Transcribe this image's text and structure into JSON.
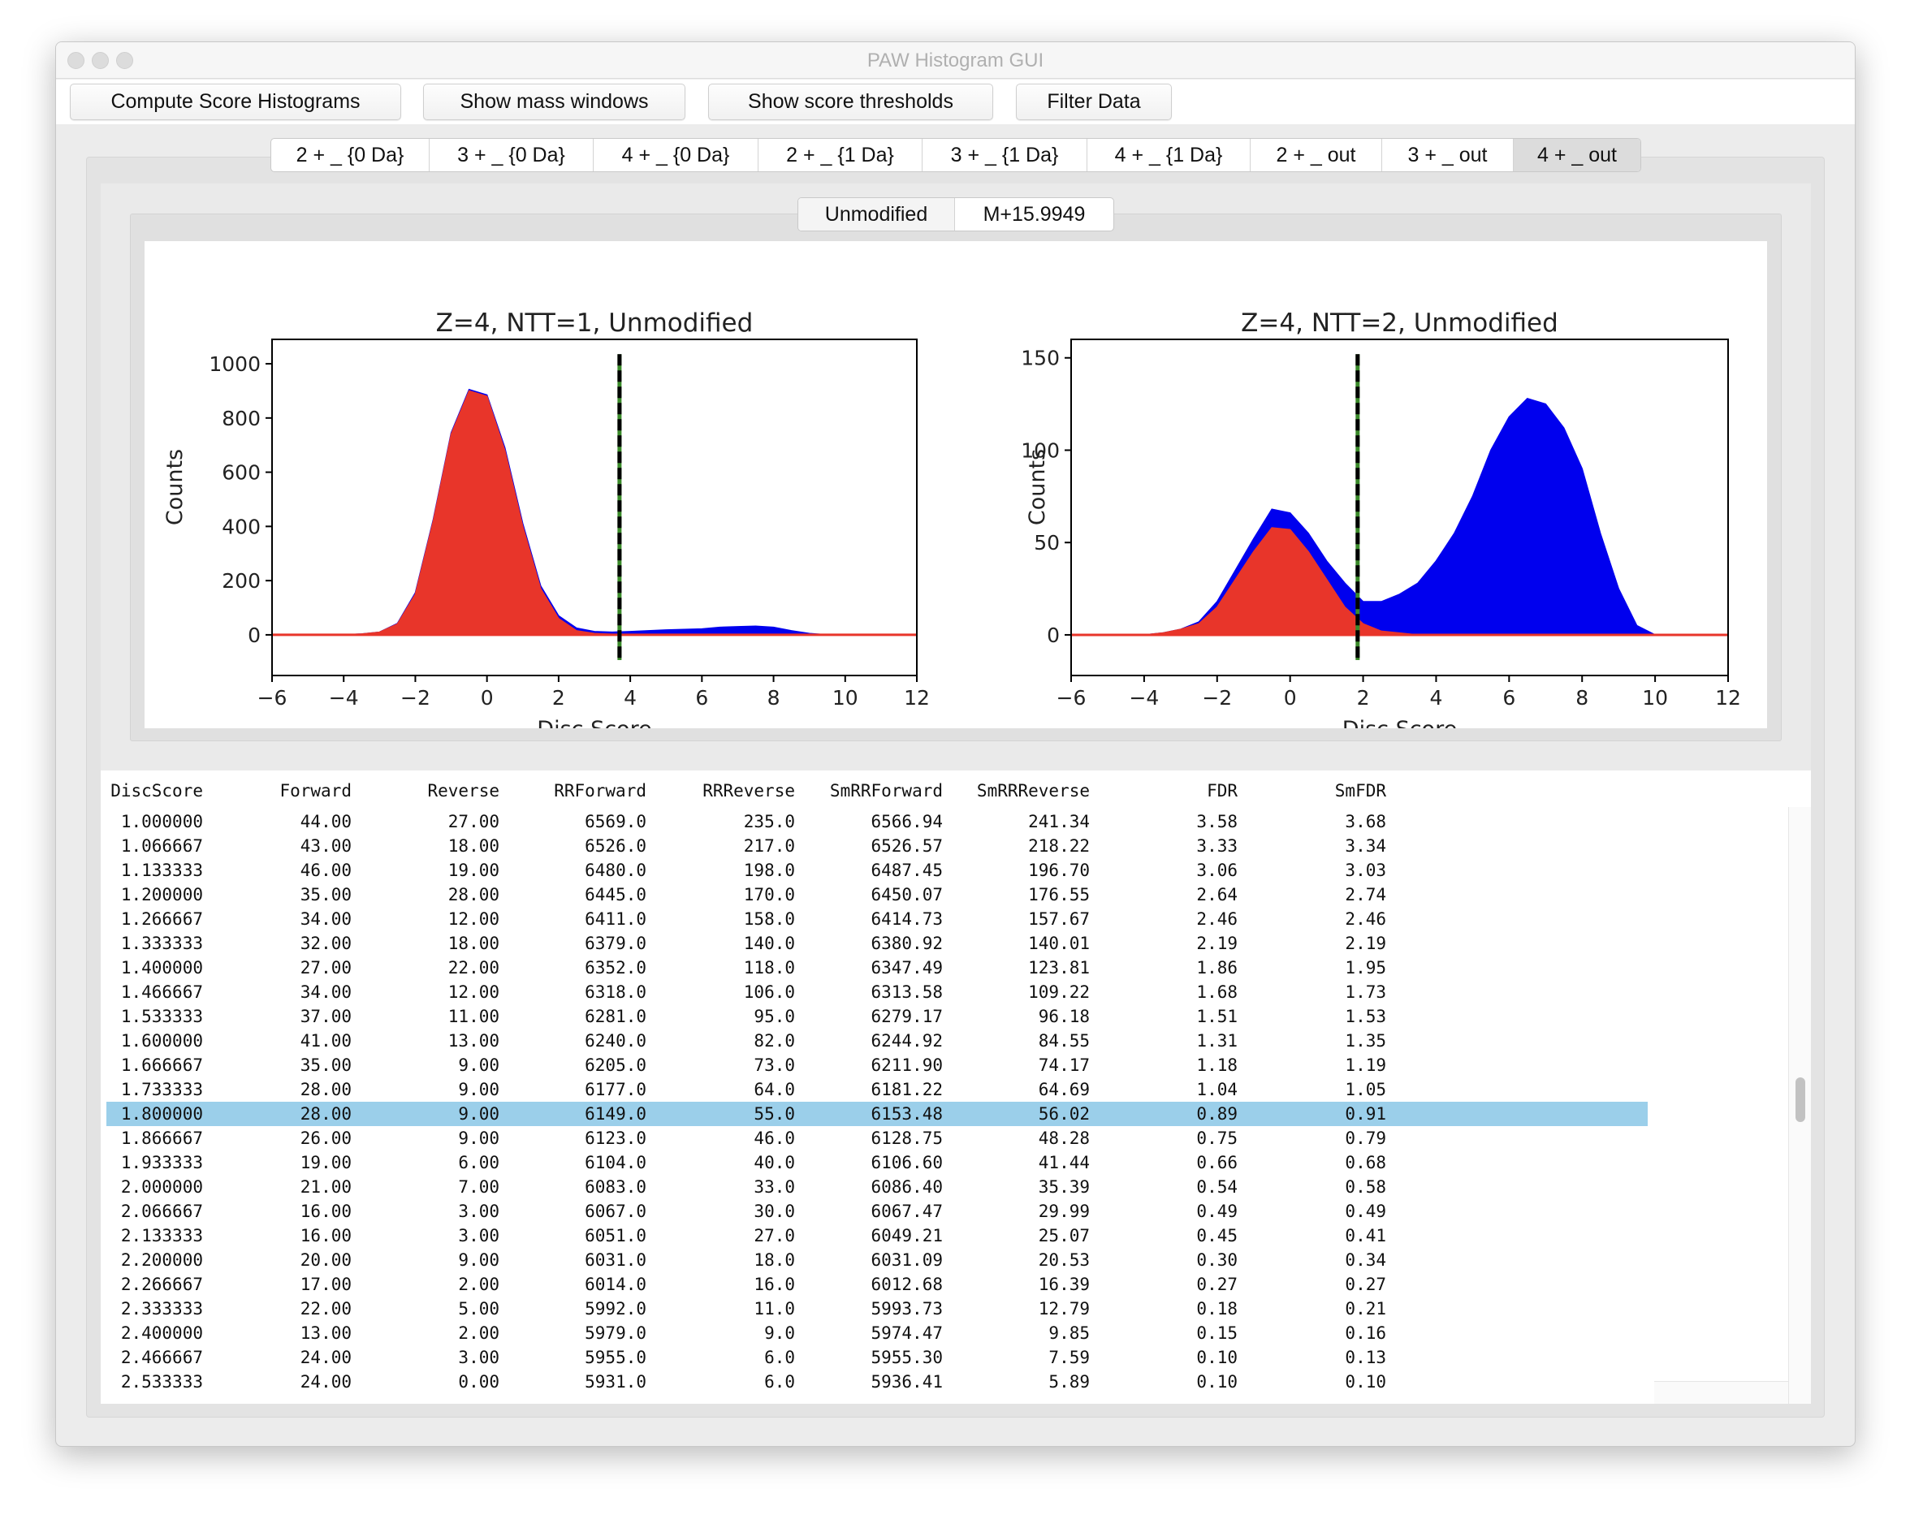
{
  "window": {
    "title": "PAW Histogram GUI"
  },
  "toolbar": {
    "buttons": [
      "Compute Score Histograms",
      "Show mass windows",
      "Show score thresholds",
      "Filter Data"
    ]
  },
  "tabs": {
    "items": [
      "2 + _ {0 Da}",
      "3 + _ {0 Da}",
      "4 + _ {0 Da}",
      "2 + _ {1 Da}",
      "3 + _ {1 Da}",
      "4 + _ {1 Da}",
      "2 + _ out",
      "3 + _ out",
      "4 + _ out"
    ],
    "selected": "4 + _ out"
  },
  "subtabs": {
    "items": [
      "Unmodified",
      "M+15.9949"
    ],
    "selected": "Unmodified"
  },
  "colors": {
    "forward": "#0000ee",
    "reverse": "#e8352a",
    "threshold": "#000000",
    "threshold_dash_alt": "#3a8a2a",
    "selected_row": "#9bcfea"
  },
  "chart_data": [
    {
      "type": "area",
      "title": "Z=4, NTT=1, Unmodified",
      "xlabel": "Disc Score",
      "ylabel": "Counts",
      "xlim": [
        -6,
        12
      ],
      "ylim": [
        -150,
        1090
      ],
      "xticks": [
        "−6",
        "−4",
        "−2",
        "0",
        "2",
        "4",
        "6",
        "8",
        "10",
        "12"
      ],
      "yticks": [
        "0",
        "200",
        "400",
        "600",
        "800",
        "1000"
      ],
      "ytick_values": [
        0,
        200,
        400,
        600,
        800,
        1000
      ],
      "threshold": 3.7,
      "x": [
        -4,
        -3.5,
        -3,
        -2.5,
        -2,
        -1.5,
        -1,
        -0.5,
        0,
        0.5,
        1,
        1.5,
        2,
        2.5,
        3,
        3.5,
        4,
        4.5,
        5,
        5.5,
        6,
        6.5,
        7,
        7.5,
        8,
        8.5,
        9,
        9.5,
        10
      ],
      "series": [
        {
          "color": "#0000ee",
          "values": [
            0,
            3,
            10,
            42,
            155,
            425,
            745,
            905,
            885,
            690,
            410,
            180,
            70,
            25,
            12,
            10,
            12,
            15,
            18,
            20,
            22,
            28,
            30,
            32,
            28,
            15,
            5,
            0,
            0
          ]
        },
        {
          "color": "#e8352a",
          "values": [
            0,
            3,
            10,
            40,
            150,
            420,
            740,
            900,
            880,
            680,
            400,
            170,
            60,
            15,
            5,
            2,
            0,
            0,
            0,
            0,
            0,
            0,
            0,
            0,
            0,
            0,
            0,
            0,
            0
          ]
        }
      ]
    },
    {
      "type": "area",
      "title": "Z=4, NTT=2, Unmodified",
      "xlabel": "Disc Score",
      "ylabel": "Counts",
      "xlim": [
        -6,
        12
      ],
      "ylim": [
        -22,
        160
      ],
      "xticks": [
        "−6",
        "−4",
        "−2",
        "0",
        "2",
        "4",
        "6",
        "8",
        "10",
        "12"
      ],
      "yticks": [
        "0",
        "50",
        "100",
        "150"
      ],
      "ytick_values": [
        0,
        50,
        100,
        150
      ],
      "threshold": 1.85,
      "x": [
        -4,
        -3.5,
        -3,
        -2.5,
        -2,
        -1.5,
        -1,
        -0.5,
        0,
        0.5,
        1,
        1.5,
        2,
        2.5,
        3,
        3.5,
        4,
        4.5,
        5,
        5.5,
        6,
        6.5,
        7,
        7.5,
        8,
        8.5,
        9,
        9.5,
        10
      ],
      "series": [
        {
          "color": "#0000ee",
          "values": [
            0,
            1,
            3,
            7,
            18,
            35,
            52,
            68,
            66,
            55,
            40,
            28,
            18,
            18,
            22,
            28,
            40,
            55,
            75,
            100,
            118,
            128,
            125,
            112,
            90,
            55,
            25,
            5,
            0
          ]
        },
        {
          "color": "#e8352a",
          "values": [
            0,
            1,
            3,
            6,
            15,
            30,
            45,
            58,
            57,
            45,
            30,
            15,
            6,
            2,
            1,
            0,
            0,
            0,
            0,
            0,
            0,
            0,
            0,
            0,
            0,
            0,
            0,
            0,
            0
          ]
        }
      ]
    }
  ],
  "table": {
    "columns": [
      "DiscScore",
      "Forward",
      "Reverse",
      "RRForward",
      "RRReverse",
      "SmRRForward",
      "SmRRReverse",
      "FDR",
      "SmFDR"
    ],
    "selected_index": 12,
    "rows": [
      [
        "1.000000",
        "44.00",
        "27.00",
        "6569.0",
        "235.0",
        "6566.94",
        "241.34",
        "3.58",
        "3.68"
      ],
      [
        "1.066667",
        "43.00",
        "18.00",
        "6526.0",
        "217.0",
        "6526.57",
        "218.22",
        "3.33",
        "3.34"
      ],
      [
        "1.133333",
        "46.00",
        "19.00",
        "6480.0",
        "198.0",
        "6487.45",
        "196.70",
        "3.06",
        "3.03"
      ],
      [
        "1.200000",
        "35.00",
        "28.00",
        "6445.0",
        "170.0",
        "6450.07",
        "176.55",
        "2.64",
        "2.74"
      ],
      [
        "1.266667",
        "34.00",
        "12.00",
        "6411.0",
        "158.0",
        "6414.73",
        "157.67",
        "2.46",
        "2.46"
      ],
      [
        "1.333333",
        "32.00",
        "18.00",
        "6379.0",
        "140.0",
        "6380.92",
        "140.01",
        "2.19",
        "2.19"
      ],
      [
        "1.400000",
        "27.00",
        "22.00",
        "6352.0",
        "118.0",
        "6347.49",
        "123.81",
        "1.86",
        "1.95"
      ],
      [
        "1.466667",
        "34.00",
        "12.00",
        "6318.0",
        "106.0",
        "6313.58",
        "109.22",
        "1.68",
        "1.73"
      ],
      [
        "1.533333",
        "37.00",
        "11.00",
        "6281.0",
        "95.0",
        "6279.17",
        "96.18",
        "1.51",
        "1.53"
      ],
      [
        "1.600000",
        "41.00",
        "13.00",
        "6240.0",
        "82.0",
        "6244.92",
        "84.55",
        "1.31",
        "1.35"
      ],
      [
        "1.666667",
        "35.00",
        "9.00",
        "6205.0",
        "73.0",
        "6211.90",
        "74.17",
        "1.18",
        "1.19"
      ],
      [
        "1.733333",
        "28.00",
        "9.00",
        "6177.0",
        "64.0",
        "6181.22",
        "64.69",
        "1.04",
        "1.05"
      ],
      [
        "1.800000",
        "28.00",
        "9.00",
        "6149.0",
        "55.0",
        "6153.48",
        "56.02",
        "0.89",
        "0.91"
      ],
      [
        "1.866667",
        "26.00",
        "9.00",
        "6123.0",
        "46.0",
        "6128.75",
        "48.28",
        "0.75",
        "0.79"
      ],
      [
        "1.933333",
        "19.00",
        "6.00",
        "6104.0",
        "40.0",
        "6106.60",
        "41.44",
        "0.66",
        "0.68"
      ],
      [
        "2.000000",
        "21.00",
        "7.00",
        "6083.0",
        "33.0",
        "6086.40",
        "35.39",
        "0.54",
        "0.58"
      ],
      [
        "2.066667",
        "16.00",
        "3.00",
        "6067.0",
        "30.0",
        "6067.47",
        "29.99",
        "0.49",
        "0.49"
      ],
      [
        "2.133333",
        "16.00",
        "3.00",
        "6051.0",
        "27.0",
        "6049.21",
        "25.07",
        "0.45",
        "0.41"
      ],
      [
        "2.200000",
        "20.00",
        "9.00",
        "6031.0",
        "18.0",
        "6031.09",
        "20.53",
        "0.30",
        "0.34"
      ],
      [
        "2.266667",
        "17.00",
        "2.00",
        "6014.0",
        "16.0",
        "6012.68",
        "16.39",
        "0.27",
        "0.27"
      ],
      [
        "2.333333",
        "22.00",
        "5.00",
        "5992.0",
        "11.0",
        "5993.73",
        "12.79",
        "0.18",
        "0.21"
      ],
      [
        "2.400000",
        "13.00",
        "2.00",
        "5979.0",
        "9.0",
        "5974.47",
        "9.85",
        "0.15",
        "0.16"
      ],
      [
        "2.466667",
        "24.00",
        "3.00",
        "5955.0",
        "6.0",
        "5955.30",
        "7.59",
        "0.10",
        "0.13"
      ],
      [
        "2.533333",
        "24.00",
        "0.00",
        "5931.0",
        "6.0",
        "5936.41",
        "5.89",
        "0.10",
        "0.10"
      ]
    ]
  }
}
